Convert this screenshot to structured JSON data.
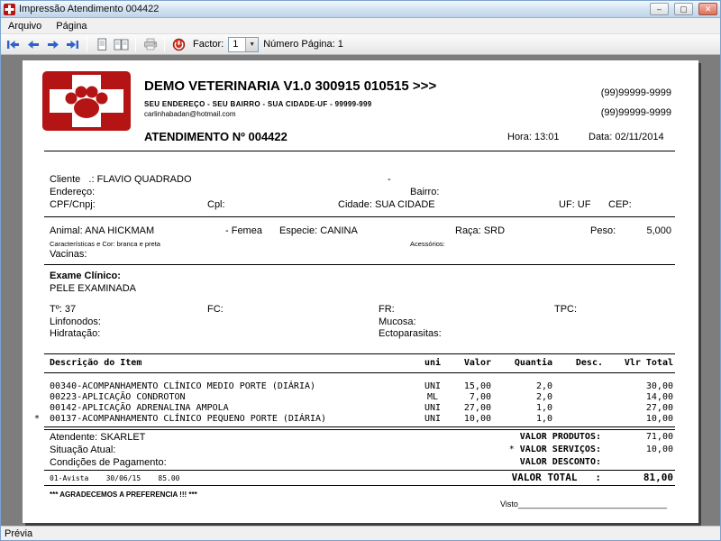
{
  "colors": {
    "logo_red": "#b51414",
    "arrow_blue": "#2f62c8",
    "preview_bg": "#7d7d7d"
  },
  "window": {
    "title": "Impressão Atendimento 004422",
    "minimize": "–",
    "maximize": "▢",
    "close": "✕",
    "status": "Prévia"
  },
  "menu": {
    "items": [
      "Arquivo",
      "Página"
    ]
  },
  "toolbar": {
    "icons": {
      "first": "first-page-arrow-icon",
      "prev": "previous-page-arrow-icon",
      "next": "next-page-arrow-icon",
      "last": "last-page-arrow-icon",
      "single_page": "single-page-view-icon",
      "double_page": "two-page-view-icon",
      "print": "printer-icon",
      "exit": "exit-preview-icon"
    },
    "factor_label": "Factor:",
    "factor_value": "1",
    "combo_arrow": "▼",
    "page_number_label": "Número Página: 1"
  },
  "report": {
    "header": {
      "clinic_name": "DEMO VETERINARIA V1.0 300915 010515 >>>",
      "address": "SEU ENDEREÇO - SEU BAIRRO - SUA CIDADE-UF - 99999-999",
      "email": "carlinhabadan@hotmail.com",
      "phone1": "(99)99999-9999",
      "phone2": "(99)99999-9999",
      "doc_title": "ATENDIMENTO Nº 004422",
      "hora": "Hora: 13:01",
      "data": "Data: 02/11/2014"
    },
    "cliente": {
      "cliente_label": "Cliente   .:",
      "cliente_value": "FLAVIO QUADRADO",
      "dash": "-",
      "endereco_label": "Endereço:",
      "bairro_label": "Bairro:",
      "cpf_label": "CPF/Cnpj:",
      "cpl_label": "Cpl:",
      "cidade_label": "Cidade:",
      "cidade_value": "SUA CIDADE",
      "uf_label": "UF:",
      "uf_value": "UF",
      "cep_label": "CEP:"
    },
    "animal": {
      "animal_label": "Animal:",
      "animal_value": "ANA HICKMAM",
      "sexo": "- Femea",
      "especie_label": "Especie:",
      "especie_value": "CANINA",
      "raca_label": "Raça:",
      "raca_value": "SRD",
      "peso_label": "Peso:",
      "peso_value": "5,000",
      "caracteristicas": "Características e Cor: branca e preta",
      "acessorios_label": "Acessórios:",
      "vacinas_label": "Vacinas:"
    },
    "exame": {
      "titulo": "Exame Clínico:",
      "valor": "PELE EXAMINADA",
      "temp": "Tº: 37",
      "fc": "FC:",
      "fr": "FR:",
      "tpc": "TPC:",
      "linfonodos": "Linfonodos:",
      "mucosa": "Mucosa:",
      "hidratacao": "Hidratação:",
      "ectoparasitas": "Ectoparasitas:"
    },
    "items": {
      "headers": [
        "Descrição do Item",
        "uni",
        "Valor",
        "Quantia",
        "Desc.",
        "Vlr Total"
      ],
      "rows": [
        {
          "mark": "",
          "descricao": "00340-ACOMPANHAMENTO CLÍNICO MEDIO PORTE (DIÁRIA)",
          "uni": "UNI",
          "valor": "15,00",
          "quantia": "2,0",
          "desconto": "",
          "total": "30,00"
        },
        {
          "mark": "",
          "descricao": "00223-APLICAÇÃO CONDROTON",
          "uni": "ML",
          "valor": "7,00",
          "quantia": "2,0",
          "desconto": "",
          "total": "14,00"
        },
        {
          "mark": "",
          "descricao": "00142-APLICAÇÃO ADRENALINA AMPOLA",
          "uni": "UNI",
          "valor": "27,00",
          "quantia": "1,0",
          "desconto": "",
          "total": "27,00"
        },
        {
          "mark": "*",
          "descricao": "00137-ACOMPANHAMENTO CLÍNICO PEQUENO PORTE (DIÁRIA)",
          "uni": "UNI",
          "valor": "10,00",
          "quantia": "1,0",
          "desconto": "",
          "total": "10,00"
        }
      ]
    },
    "footer": {
      "atendente": "Atendente: SKARLET",
      "situacao": "Situação Atual:",
      "condicoes": "Condições de Pagamento:",
      "pagamento": "01-Avista    30/06/15    85.00",
      "totais": [
        {
          "mark": "",
          "label": "VALOR PRODUTOS:",
          "value": "71,00"
        },
        {
          "mark": "*",
          "label": "VALOR SERVIÇOS:",
          "value": "10,00"
        },
        {
          "mark": "",
          "label": "VALOR DESCONTO:",
          "value": ""
        },
        {
          "mark": "",
          "label": "VALOR TOTAL   :",
          "value": "81,00"
        }
      ],
      "agradecimento": "*** AGRADECEMOS A PREFERENCIA !!! ***",
      "visto": "Visto_________________________________"
    }
  }
}
